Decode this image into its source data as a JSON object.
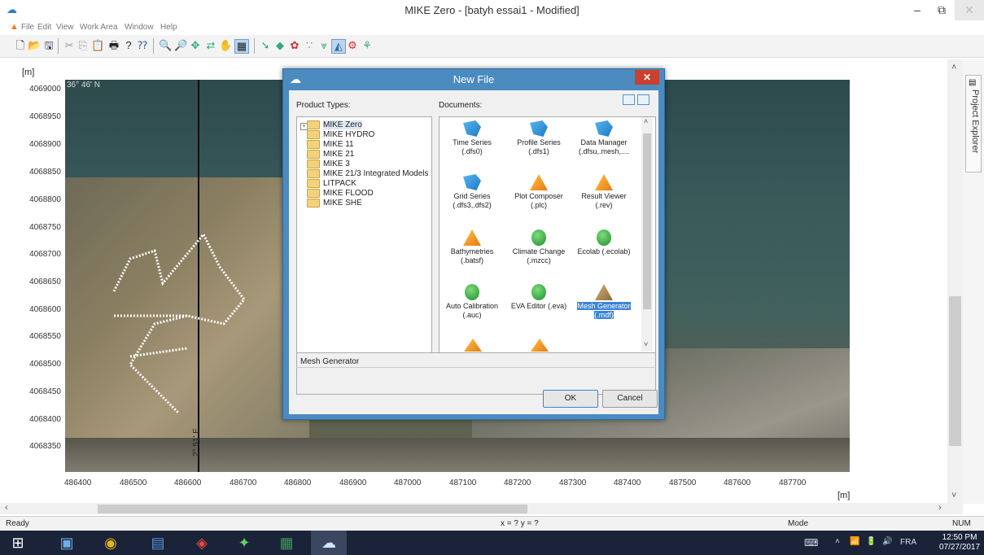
{
  "window": {
    "title": "MIKE Zero - [batyh essai1 - Modified]",
    "minimize": "–",
    "restore": "⧉",
    "close": "✕"
  },
  "menu": [
    "File",
    "Edit",
    "View",
    "Work Area",
    "Window",
    "Help"
  ],
  "map": {
    "y_unit": "[m]",
    "x_unit": "[m]",
    "y_ticks": [
      "4069000",
      "4068950",
      "4068900",
      "4068850",
      "4068800",
      "4068750",
      "4068700",
      "4068650",
      "4068600",
      "4068550",
      "4068500",
      "4068450",
      "4068400",
      "4068350"
    ],
    "x_ticks": [
      "486400",
      "486500",
      "486600",
      "486700",
      "486800",
      "486900",
      "487000",
      "487100",
      "487200",
      "487300",
      "487400",
      "487500",
      "487600",
      "487700"
    ],
    "lat_label": "36° 46' N",
    "lon_label": "2° 51' E"
  },
  "project_explorer": "Project Explorer",
  "status": {
    "left": "Ready",
    "coords": "x = ? y = ?",
    "mode": "Mode",
    "num": "NUM"
  },
  "tray": {
    "lang": "FRA",
    "time": "12:50 PM",
    "date": "07/27/2017"
  },
  "dialog": {
    "title": "New File",
    "product_types_label": "Product Types:",
    "documents_label": "Documents:",
    "product_types": [
      "MIKE Zero",
      "MIKE HYDRO",
      "MIKE 11",
      "MIKE 21",
      "MIKE 3",
      "MIKE 21/3 Integrated Models",
      "LITPACK",
      "MIKE FLOOD",
      "MIKE SHE"
    ],
    "documents": [
      {
        "label": "Time Series (.dfs0)",
        "icon": "blue"
      },
      {
        "label": "Profile Series (.dfs1)",
        "icon": "blue"
      },
      {
        "label": "Data Manager (.dfsu,.mesh,....",
        "icon": "blue"
      },
      {
        "label": "Grid Series (.dfs3,.dfs2)",
        "icon": "blue"
      },
      {
        "label": "Plot Composer (.plc)",
        "icon": "orange"
      },
      {
        "label": "Result Viewer (.rev)",
        "icon": "orange"
      },
      {
        "label": "Bathymetries (.batsf)",
        "icon": "orange"
      },
      {
        "label": "Climate Change (.mzcc)",
        "icon": "green"
      },
      {
        "label": "Ecolab (.ecolab)",
        "icon": "green"
      },
      {
        "label": "Auto Calibration (.auc)",
        "icon": "green"
      },
      {
        "label": "EVA Editor (.eva)",
        "icon": "green"
      },
      {
        "label": "Mesh Generator (.mdf)",
        "icon": "tan"
      }
    ],
    "description": "Mesh Generator",
    "ok": "OK",
    "cancel": "Cancel"
  }
}
